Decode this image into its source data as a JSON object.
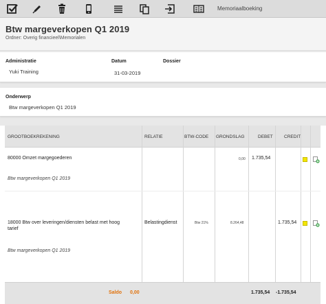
{
  "toolbar": {
    "label": "Memoriaalboeking",
    "icons": [
      "checkbox-save-icon",
      "pencil-icon",
      "trash-icon",
      "mobile-icon",
      "list-icon",
      "copy-icon",
      "import-icon",
      "document-icon"
    ]
  },
  "header": {
    "title": "Btw margeverkopen Q1 2019",
    "folder": "Ordner: Overig financieel\\Memorialen"
  },
  "meta": {
    "administratie_label": "Administratie",
    "administratie_value": "Yuki Training",
    "datum_label": "Datum",
    "datum_value": "31-03-2019",
    "dossier_label": "Dossier",
    "dossier_value": ""
  },
  "subject": {
    "label": "Onderwerp",
    "value": "Btw margeverkopen Q1 2019"
  },
  "table": {
    "headers": {
      "grootboek": "GROOTBOEKREKENING",
      "relatie": "RELATIE",
      "btwcode": "BTW-CODE",
      "grondslag": "GRONDSLAG",
      "debet": "DEBET",
      "credit": "CREDIT"
    },
    "rows": [
      {
        "account": "80000 Omzet margegoederen",
        "account_line2": "",
        "relatie": "",
        "btwcode": "",
        "grondslag": "0,00",
        "debet": "1.735,54",
        "credit": "",
        "description": "Btw margeverkopen Q1 2019"
      },
      {
        "account": "18000 Btw over leveringen/diensten belast met hoog",
        "account_line2": "tarief",
        "relatie": "Belastingdienst",
        "btwcode": "Btw 21%",
        "grondslag": "8.264,48",
        "debet": "",
        "credit": "1.735,54",
        "description": "Btw margeverkopen Q1 2019"
      }
    ],
    "footer": {
      "saldo_label": "Saldo",
      "saldo_value": "0,00",
      "debet_total": "1.735,54",
      "credit_total": "-1.735,54"
    }
  },
  "colors": {
    "accent_orange": "#e1720c",
    "status_yellow": "#f3e600",
    "add_green": "#3ca34a"
  }
}
